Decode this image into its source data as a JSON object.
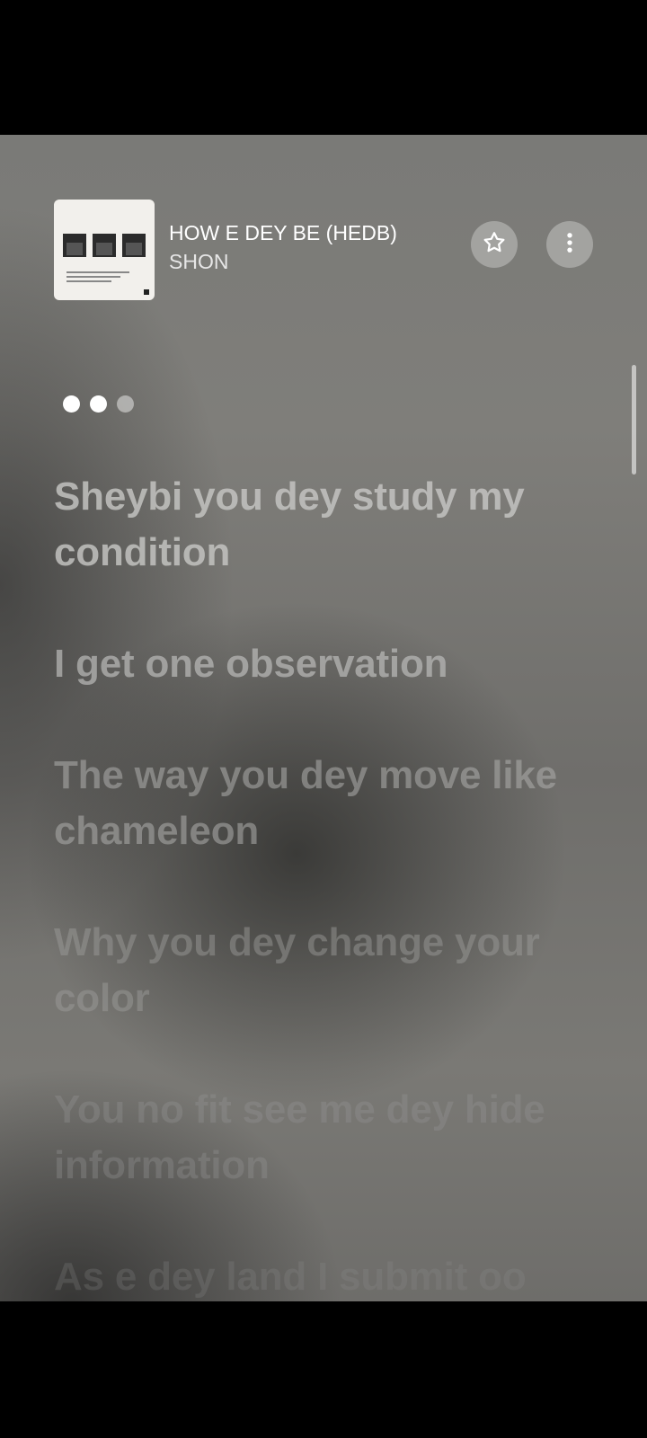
{
  "track": {
    "title": "HOW E DEY BE (HEDB)",
    "artist": "SHON"
  },
  "icons": {
    "favorite": "star-icon",
    "more": "more-vertical-icon"
  },
  "pager": {
    "total_dots": 3,
    "active_dots": 2
  },
  "lyrics": [
    "Sheybi you dey study my condition",
    "I get one observation",
    "The way you dey move like chameleon",
    "Why you dey change your color",
    "You no fit see me dey hide information",
    "As e dey land I submit oo"
  ]
}
